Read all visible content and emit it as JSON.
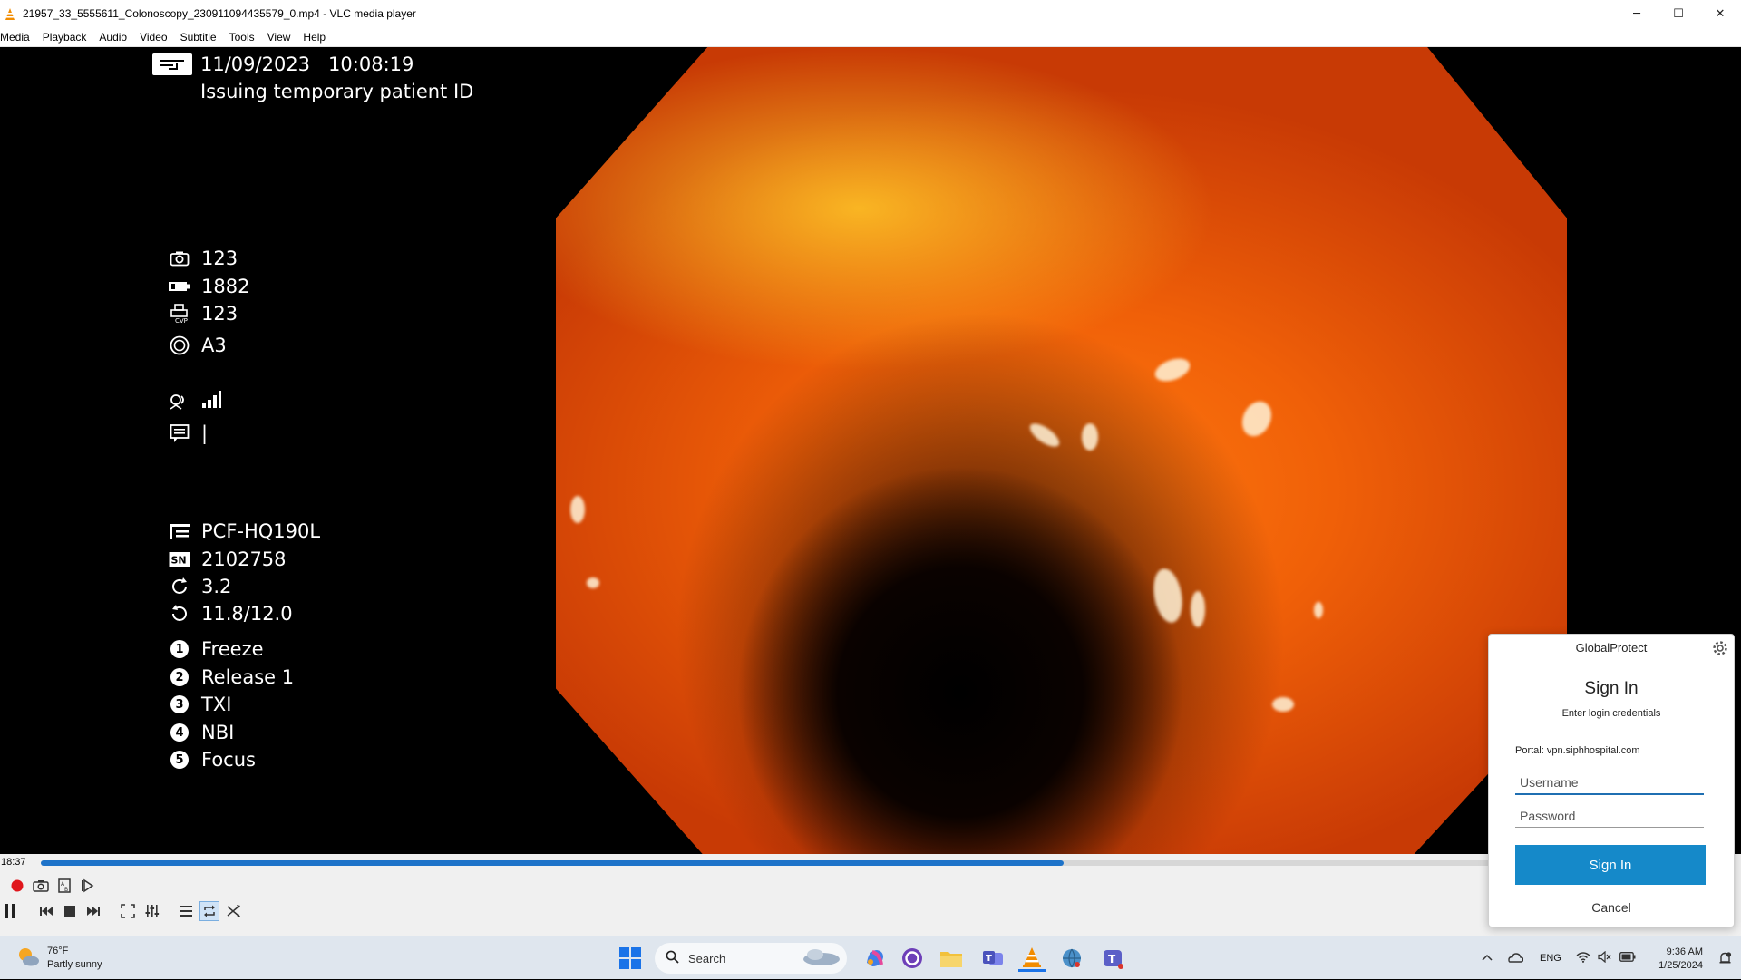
{
  "window": {
    "title": "21957_33_5555611_Colonoscopy_230911094435579_0.mp4 - VLC media player",
    "minimize": "─",
    "maximize": "☐",
    "close": "✕"
  },
  "menu": [
    "Media",
    "Playback",
    "Audio",
    "Video",
    "Subtitle",
    "Tools",
    "View",
    "Help"
  ],
  "overlay": {
    "date": "11/09/2023",
    "time": "10:08:19",
    "patient_status": "Issuing temporary patient ID",
    "stats": [
      {
        "icon": "camera-icon",
        "value": "123"
      },
      {
        "icon": "battery-icon",
        "value": "1882"
      },
      {
        "icon": "printer-cvp-icon",
        "value": "123"
      },
      {
        "icon": "face-icon",
        "value": "A3"
      }
    ],
    "comment_value": "|",
    "scope": [
      {
        "icon": "scope-model-icon",
        "value": "PCF-HQ190L"
      },
      {
        "icon": "serial-number-icon",
        "value": "2102758"
      },
      {
        "icon": "rotate-icon",
        "value": "3.2"
      },
      {
        "icon": "cycle-icon",
        "value": "11.8/12.0"
      }
    ],
    "buttons": [
      {
        "num": "1",
        "label": "Freeze"
      },
      {
        "num": "2",
        "label": "Release 1"
      },
      {
        "num": "3",
        "label": "TXI"
      },
      {
        "num": "4",
        "label": "NBI"
      },
      {
        "num": "5",
        "label": "Focus"
      }
    ]
  },
  "player": {
    "current_time": "18:37",
    "progress": 0.705
  },
  "globalprotect": {
    "header": "GlobalProtect",
    "title": "Sign In",
    "subtitle": "Enter login credentials",
    "portal": "Portal: vpn.siphhospital.com",
    "username_placeholder": "Username",
    "password_placeholder": "Password",
    "signin_label": "Sign In",
    "cancel_label": "Cancel"
  },
  "taskbar": {
    "weather_temp": "76°F",
    "weather_desc": "Partly sunny",
    "search_label": "Search",
    "lang": "ENG",
    "time": "9:36 AM",
    "date": "1/25/2024"
  },
  "colors": {
    "accent": "#1589c9",
    "seek_fill": "#1e73c9"
  }
}
